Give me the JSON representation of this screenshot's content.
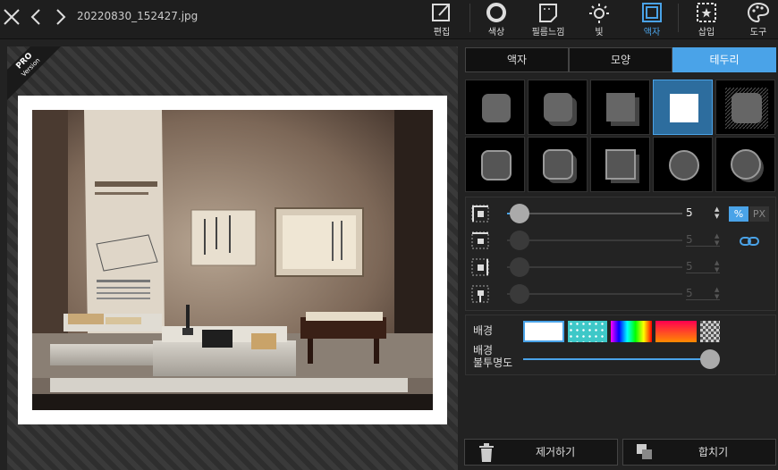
{
  "header": {
    "filename": "20220830_152427.jpg",
    "tools": [
      {
        "label": "편집",
        "icon": "edit-icon"
      },
      {
        "label": "색상",
        "icon": "color-icon"
      },
      {
        "label": "필름느낌",
        "icon": "film-icon"
      },
      {
        "label": "빛",
        "icon": "light-icon"
      },
      {
        "label": "액자",
        "icon": "frame-icon"
      },
      {
        "label": "삽입",
        "icon": "insert-icon"
      },
      {
        "label": "도구",
        "icon": "palette-icon"
      }
    ],
    "active_tool": "액자"
  },
  "canvas": {
    "badge_main": "PRO",
    "badge_sub": "Version"
  },
  "panel": {
    "tabs": [
      "액자",
      "모양",
      "테두리"
    ],
    "active_tab": "테두리",
    "border": {
      "values": [
        "5",
        "5",
        "5",
        "5"
      ],
      "unit_percent": "%",
      "unit_px": "PX",
      "active_unit": "%"
    },
    "background": {
      "label": "배경",
      "opacity_label_1": "배경",
      "opacity_label_2": "불투명도",
      "opacity": 1.0
    },
    "remove_label": "제거하기",
    "merge_label": "합치기"
  },
  "colors": {
    "accent": "#4aa3e8",
    "panel_bg": "#222222"
  }
}
